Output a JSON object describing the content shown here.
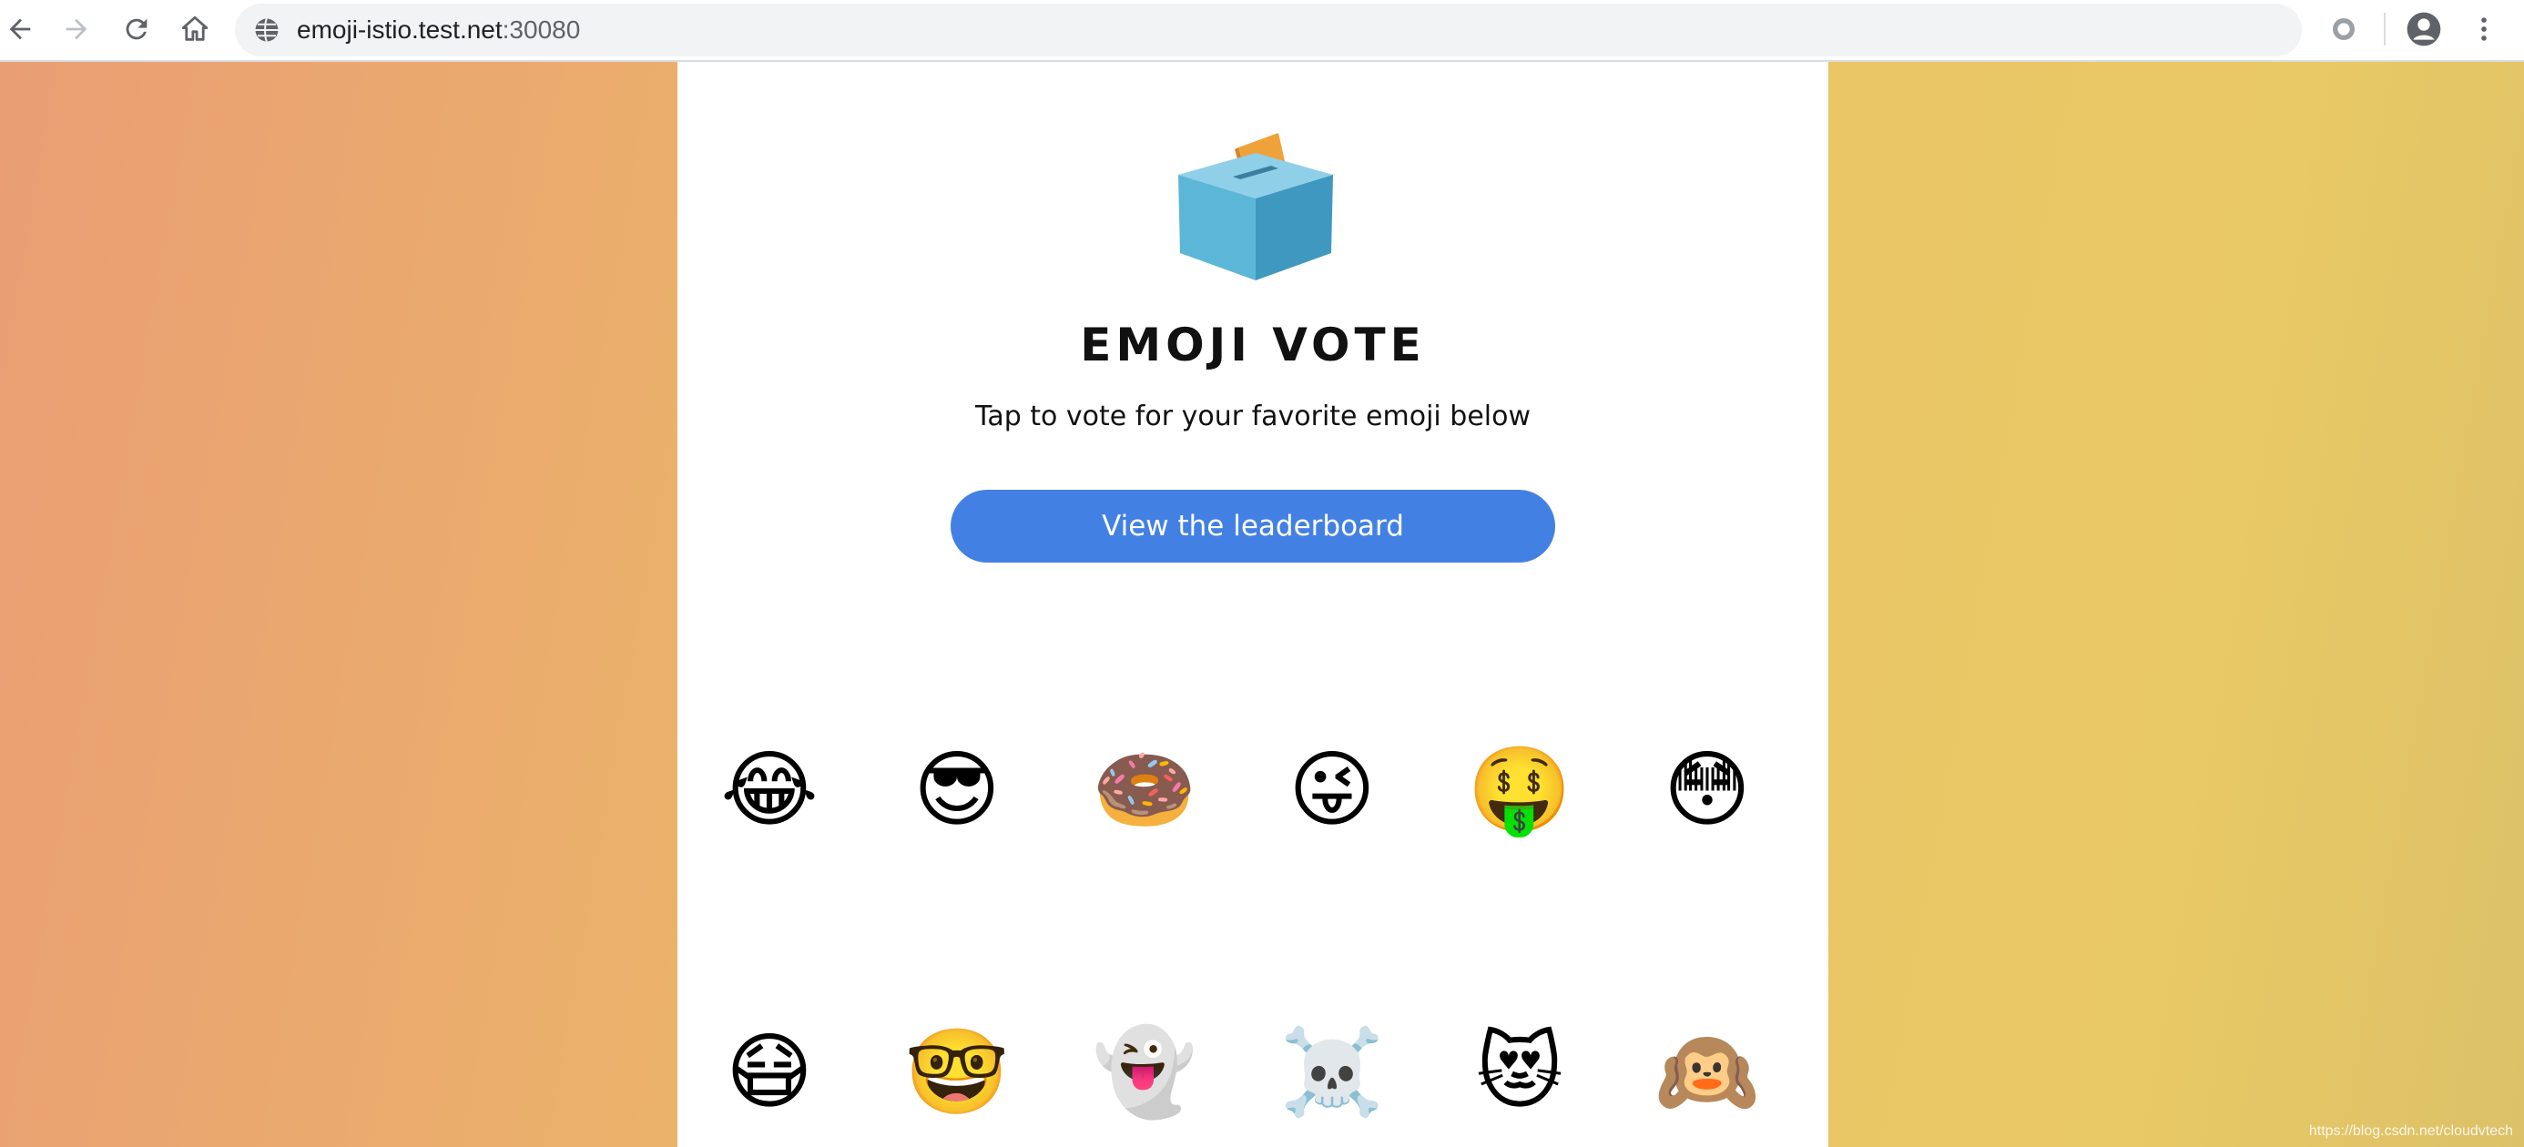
{
  "browser": {
    "url_host": "emoji-istio.test.net",
    "url_port": ":30080",
    "icons": [
      "back-arrow-icon",
      "forward-arrow-icon",
      "reload-icon",
      "home-icon",
      "globe-icon",
      "extension-circle-icon",
      "profile-icon",
      "more-vertical-icon"
    ]
  },
  "page": {
    "title": "EMOJI VOTE",
    "subtitle": "Tap to vote for your favorite emoji below",
    "leaderboard_button": "View the leaderboard",
    "colors": {
      "button": "#4380e4",
      "bg_left": "#e99e74",
      "bg_right": "#e9c965"
    }
  },
  "emojis": {
    "row1": [
      "😂",
      "😎",
      "🍩",
      "😜",
      "🤑",
      "😳"
    ],
    "row2": [
      "😷",
      "🤓",
      "👻",
      "☠️",
      "😻",
      "🙉"
    ]
  },
  "watermark": "https://blog.csdn.net/cloudvtech"
}
